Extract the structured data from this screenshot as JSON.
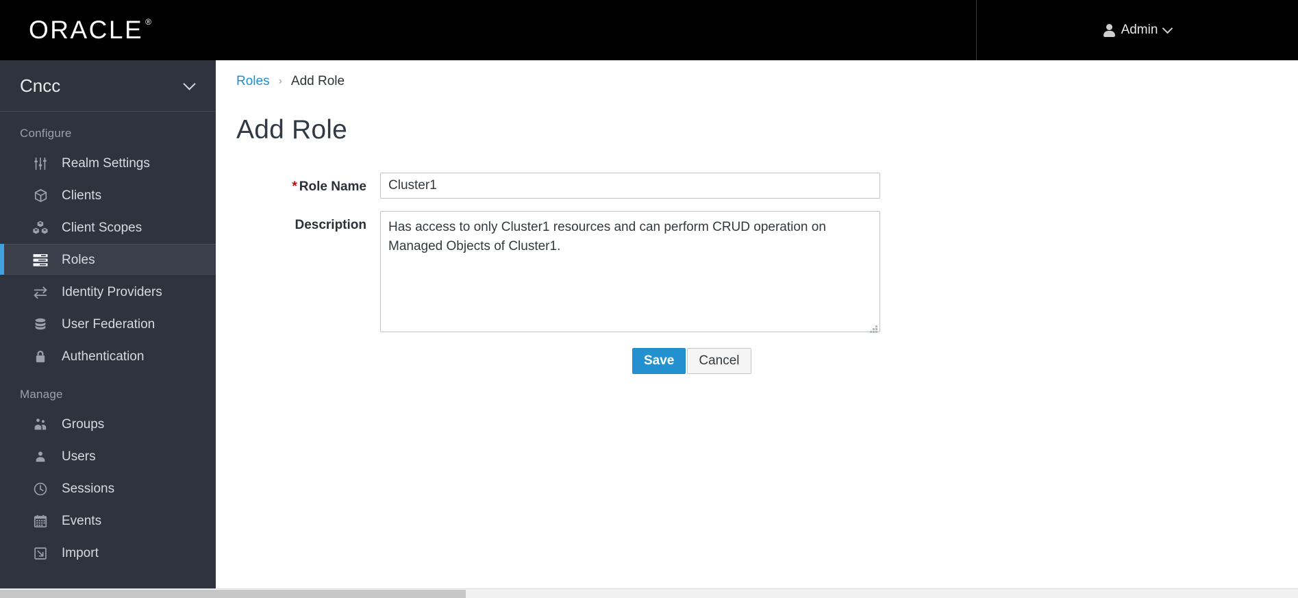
{
  "topbar": {
    "brand": "ORACLE",
    "brand_registered": "®",
    "user_label": "Admin",
    "user_icon": "person-icon",
    "chevron_icon": "chevron-down-icon"
  },
  "sidebar": {
    "realm": {
      "name": "Cncc",
      "chevron_icon": "chevron-down-icon"
    },
    "sections": [
      {
        "label": "Configure",
        "items": [
          {
            "label": "Realm Settings",
            "icon": "sliders-icon",
            "active": false
          },
          {
            "label": "Clients",
            "icon": "cube-icon",
            "active": false
          },
          {
            "label": "Client Scopes",
            "icon": "cubes-icon",
            "active": false
          },
          {
            "label": "Roles",
            "icon": "list-rows-icon",
            "active": true
          },
          {
            "label": "Identity Providers",
            "icon": "exchange-arrows-icon",
            "active": false
          },
          {
            "label": "User Federation",
            "icon": "database-icon",
            "active": false
          },
          {
            "label": "Authentication",
            "icon": "lock-icon",
            "active": false
          }
        ]
      },
      {
        "label": "Manage",
        "items": [
          {
            "label": "Groups",
            "icon": "users-group-icon",
            "active": false
          },
          {
            "label": "Users",
            "icon": "user-icon",
            "active": false
          },
          {
            "label": "Sessions",
            "icon": "clock-icon",
            "active": false
          },
          {
            "label": "Events",
            "icon": "calendar-icon",
            "active": false
          },
          {
            "label": "Import",
            "icon": "import-arrow-icon",
            "active": false
          }
        ]
      }
    ]
  },
  "main": {
    "breadcrumb": {
      "parent": "Roles",
      "separator": "›",
      "current": "Add Role"
    },
    "title": "Add Role",
    "form": {
      "role_name": {
        "label": "Role Name",
        "required_marker": "*",
        "value": "Cluster1",
        "placeholder": ""
      },
      "description": {
        "label": "Description",
        "value": "Has access to only Cluster1 resources and can perform CRUD operation on Managed Objects of Cluster1.",
        "placeholder": ""
      }
    },
    "buttons": {
      "save": "Save",
      "cancel": "Cancel"
    }
  },
  "colors": {
    "brand_black": "#000000",
    "sidebar_bg": "#2f333d",
    "sidebar_active_bg": "#3a3f4b",
    "accent_blue": "#3fa2dc",
    "link_blue": "#1f8fd1",
    "primary_button": "#2391cf",
    "required_red": "#cc0000"
  }
}
